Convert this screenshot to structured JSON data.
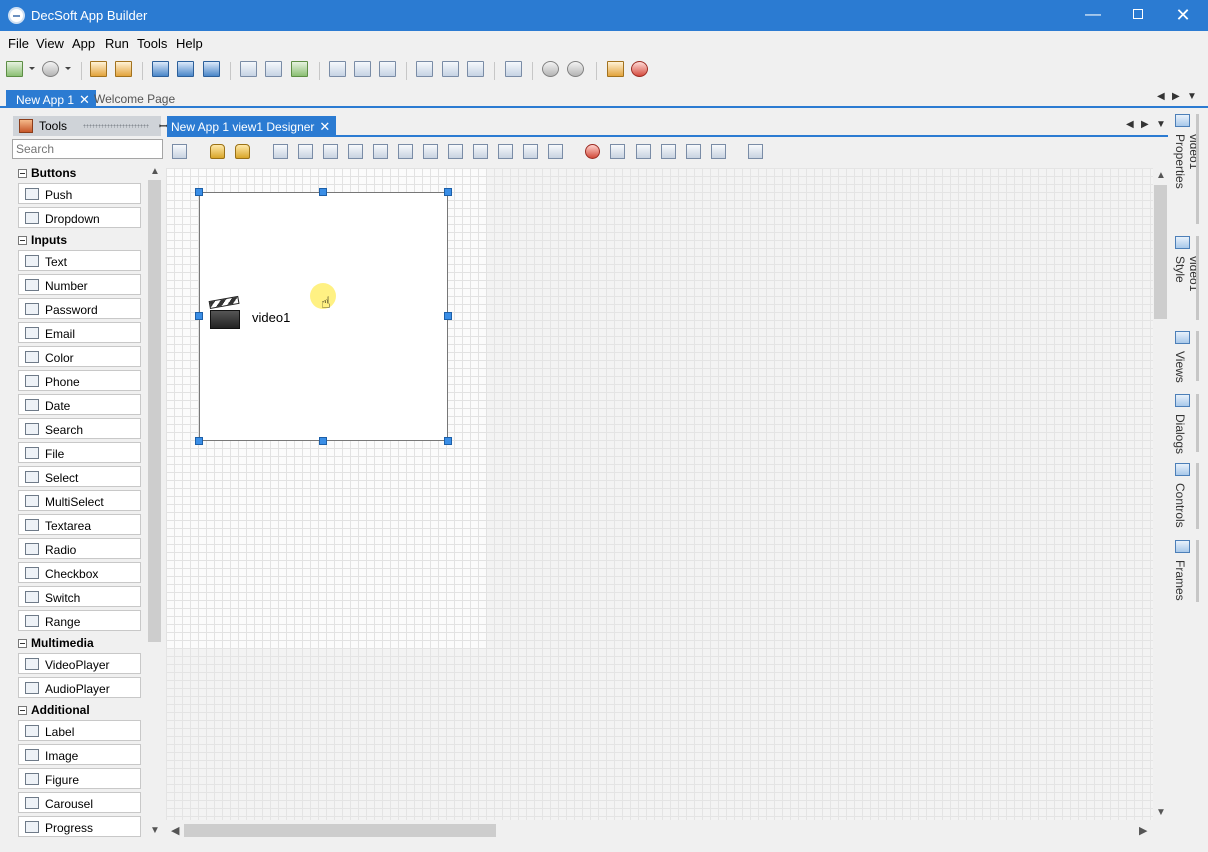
{
  "window": {
    "title": "DecSoft App Builder",
    "controls": {
      "minimize": "—",
      "close": "✕"
    }
  },
  "menu": [
    "File",
    "View",
    "App",
    "Run",
    "Tools",
    "Help"
  ],
  "doc_tabs": {
    "active": "New App 1",
    "inactive": "Welcome Page",
    "close": "✕"
  },
  "tools_panel": {
    "title": "Tools",
    "pin": "📌",
    "search_placeholder": "Search",
    "categories": [
      {
        "name": "Buttons",
        "items": [
          "Push",
          "Dropdown"
        ]
      },
      {
        "name": "Inputs",
        "items": [
          "Text",
          "Number",
          "Password",
          "Email",
          "Color",
          "Phone",
          "Date",
          "Search",
          "File",
          "Select",
          "MultiSelect",
          "Textarea",
          "Radio",
          "Checkbox",
          "Switch",
          "Range"
        ]
      },
      {
        "name": "Multimedia",
        "items": [
          "VideoPlayer",
          "AudioPlayer"
        ]
      },
      {
        "name": "Additional",
        "items": [
          "Label",
          "Image",
          "Figure",
          "Carousel",
          "Progress"
        ]
      }
    ]
  },
  "designer": {
    "tab_label": "New App 1 view1 Designer",
    "close": "✕",
    "control_label": "video1"
  },
  "side_tabs": [
    "video1 Properties",
    "video1 Style",
    "Views",
    "Dialogs",
    "Controls",
    "Frames"
  ],
  "colors": {
    "accent": "#2b7bd2",
    "handle": "#3a8ee6"
  }
}
